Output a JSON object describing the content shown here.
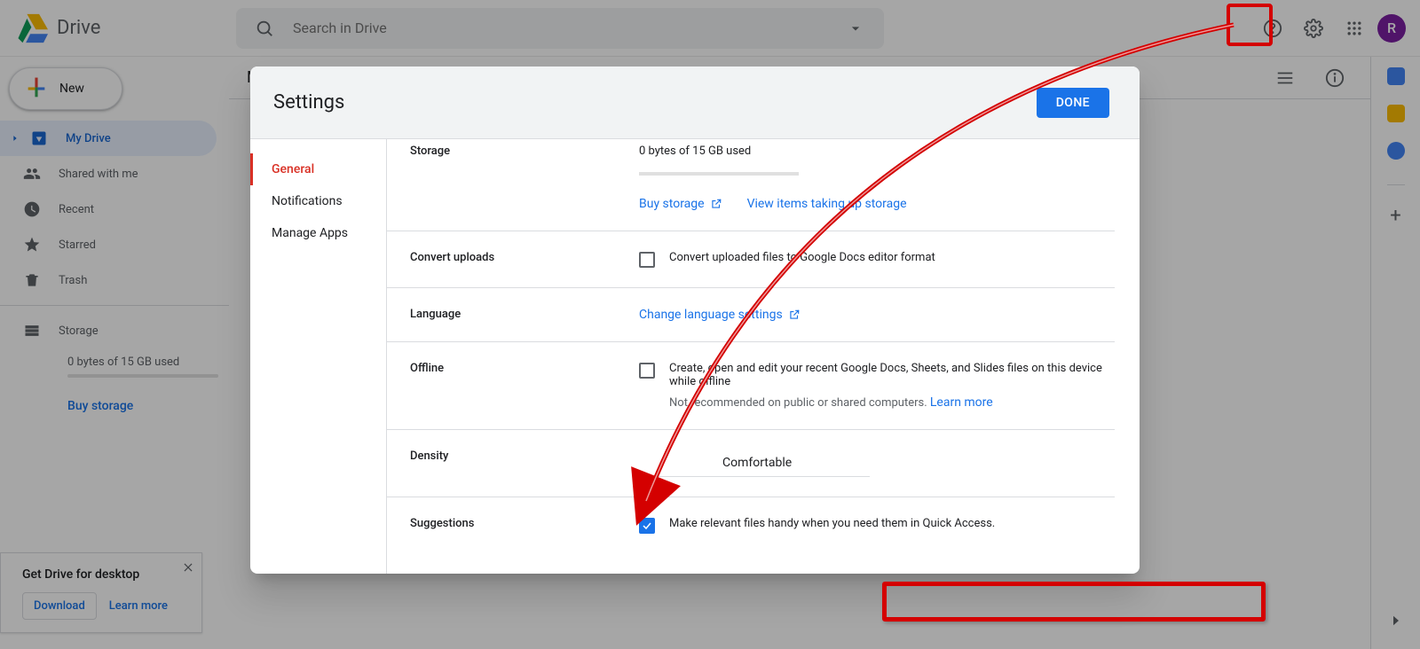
{
  "brand": {
    "name": "Drive"
  },
  "search": {
    "placeholder": "Search in Drive"
  },
  "new_button": {
    "label": "New"
  },
  "sidebar": {
    "items": [
      {
        "label": "My Drive"
      },
      {
        "label": "Shared with me"
      },
      {
        "label": "Recent"
      },
      {
        "label": "Starred"
      },
      {
        "label": "Trash"
      }
    ],
    "storage_label": "Storage",
    "storage_used": "0 bytes of 15 GB used",
    "buy_storage": "Buy storage"
  },
  "content": {
    "breadcrumb": "My Drive"
  },
  "avatar": {
    "initial": "R"
  },
  "promo": {
    "title": "Get Drive for desktop",
    "download": "Download",
    "learn": "Learn more"
  },
  "dialog": {
    "title": "Settings",
    "done": "DONE",
    "nav": [
      "General",
      "Notifications",
      "Manage Apps"
    ],
    "sections": {
      "storage": {
        "label": "Storage",
        "used": "0 bytes of 15 GB used",
        "buy": "Buy storage",
        "view_items": "View items taking up storage"
      },
      "convert": {
        "label": "Convert uploads",
        "opt": "Convert uploaded files to Google Docs editor format"
      },
      "language": {
        "label": "Language",
        "link": "Change language settings"
      },
      "offline": {
        "label": "Offline",
        "opt": "Create, open and edit your recent Google Docs, Sheets, and Slides files on this device while offline",
        "warn": "Not recommended on public or shared computers. ",
        "learn": "Learn more"
      },
      "density": {
        "label": "Density",
        "value": "Comfortable"
      },
      "suggestions": {
        "label": "Suggestions",
        "opt": "Make relevant files handy when you need them in Quick Access."
      }
    }
  }
}
